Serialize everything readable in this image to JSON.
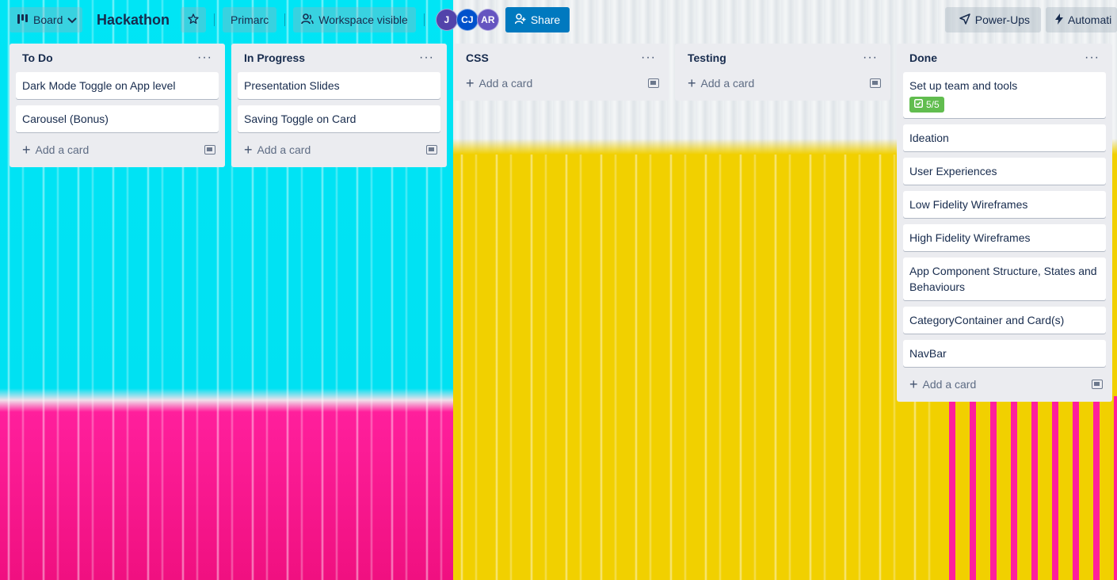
{
  "header": {
    "board_switch_label": "Board",
    "board_title": "Hackathon",
    "workspace_label": "Primarc",
    "visibility_label": "Workspace visible",
    "share_label": "Share",
    "powerups_label": "Power-Ups",
    "automation_label": "Automati",
    "avatars": [
      {
        "initials": "J",
        "color": "#5243aa"
      },
      {
        "initials": "CJ",
        "color": "#0052cc"
      },
      {
        "initials": "AR",
        "color": "#6554c0"
      }
    ]
  },
  "lists": [
    {
      "title": "To Do",
      "cards": [
        "Dark Mode Toggle on App level",
        "Carousel (Bonus)"
      ],
      "add_label": "Add a card"
    },
    {
      "title": "In Progress",
      "cards": [
        "Presentation Slides",
        "Saving Toggle on Card"
      ],
      "add_label": "Add a card"
    },
    {
      "title": "CSS",
      "cards": [],
      "add_label": "Add a card"
    },
    {
      "title": "Testing",
      "cards": [],
      "add_label": "Add a card"
    },
    {
      "title": "Done",
      "cards": [
        "Set up team and tools",
        "Ideation",
        "User Experiences",
        "Low Fidelity Wireframes",
        "High Fidelity Wireframes",
        "App Component Structure, States and Behaviours",
        "CategoryContainer and Card(s)",
        "NavBar"
      ],
      "add_label": "Add a card",
      "checklist_badge": "5/5"
    }
  ],
  "icons": {
    "board": "board-icon",
    "chevron": "chevron-down-icon",
    "star": "star-icon",
    "visibility": "people-icon",
    "share": "add-person-icon",
    "powerups": "rocket-icon",
    "automation": "lightning-icon",
    "menu": "ellipsis-icon",
    "add": "plus-icon",
    "template": "template-icon",
    "checklist": "checkbox-icon"
  },
  "colors": {
    "share_button": "#0079bf",
    "list_background": "#ebecf0",
    "checklist_complete": "#61bd4f"
  }
}
